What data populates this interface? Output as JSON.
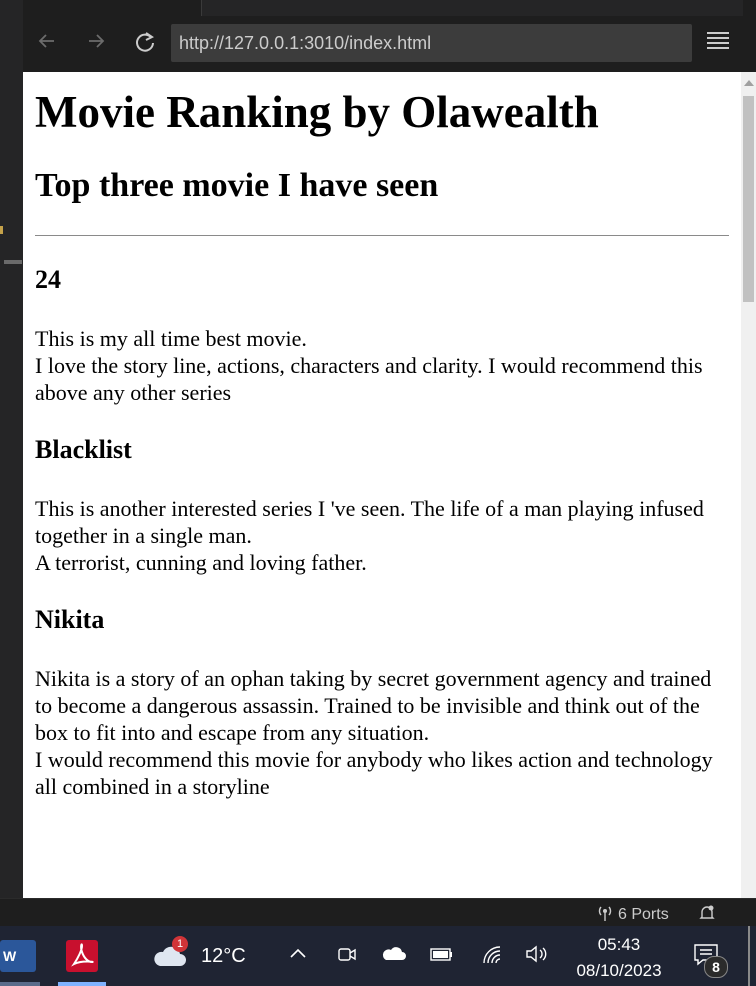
{
  "browser": {
    "url": "http://127.0.0.1:3010/index.html"
  },
  "page": {
    "title": "Movie Ranking by Olawealth",
    "subtitle": "Top three movie I have seen",
    "movies": [
      {
        "name": "24",
        "lines": [
          "This is my all time best movie.",
          "I love the story line, actions, characters and clarity. I would recommend this above any other series"
        ]
      },
      {
        "name": "Blacklist",
        "lines": [
          "This is another interested series I 've seen. The life of a man playing infused together in a single man.",
          "A terrorist, cunning and loving father."
        ]
      },
      {
        "name": "Nikita",
        "lines": [
          "Nikita is a story of an ophan taking by secret government agency and trained to become a dangerous assassin. Trained to be invisible and think out of the box to fit into and escape from any situation.",
          "I would recommend this movie for anybody who likes action and technology all combined in a storyline"
        ]
      }
    ]
  },
  "statusbar": {
    "ports_label": "6 Ports"
  },
  "taskbar": {
    "word_label": "W",
    "weather_badge": "1",
    "temperature": "12°C",
    "time": "05:43",
    "date": "08/10/2023",
    "notification_count": "8"
  }
}
